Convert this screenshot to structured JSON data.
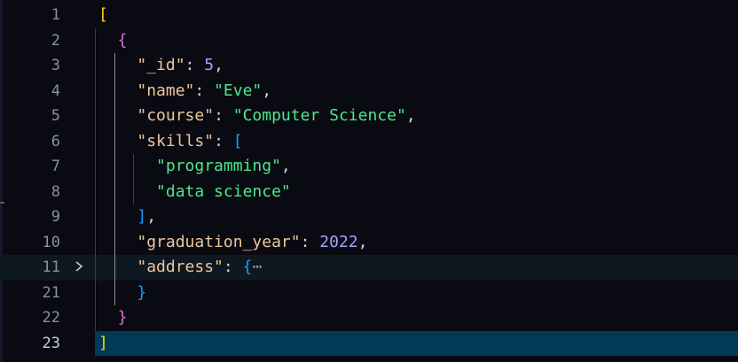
{
  "editor": {
    "lines": [
      {
        "num": "1",
        "tokens": [
          {
            "t": "[",
            "c": "t-bracket1"
          }
        ],
        "indent": 0
      },
      {
        "num": "2",
        "tokens": [
          {
            "t": "{",
            "c": "t-bracket2"
          }
        ],
        "indent": 1
      },
      {
        "num": "3",
        "tokens": [
          {
            "t": "\"_id\"",
            "c": "t-key"
          },
          {
            "t": ": ",
            "c": "t-punc"
          },
          {
            "t": "5",
            "c": "t-num"
          },
          {
            "t": ",",
            "c": "t-punc"
          }
        ],
        "indent": 2
      },
      {
        "num": "4",
        "tokens": [
          {
            "t": "\"name\"",
            "c": "t-key"
          },
          {
            "t": ": ",
            "c": "t-punc"
          },
          {
            "t": "\"Eve\"",
            "c": "t-str"
          },
          {
            "t": ",",
            "c": "t-punc"
          }
        ],
        "indent": 2
      },
      {
        "num": "5",
        "tokens": [
          {
            "t": "\"course\"",
            "c": "t-key"
          },
          {
            "t": ": ",
            "c": "t-punc"
          },
          {
            "t": "\"Computer Science\"",
            "c": "t-str"
          },
          {
            "t": ",",
            "c": "t-punc"
          }
        ],
        "indent": 2
      },
      {
        "num": "6",
        "tokens": [
          {
            "t": "\"skills\"",
            "c": "t-key"
          },
          {
            "t": ": ",
            "c": "t-punc"
          },
          {
            "t": "[",
            "c": "t-bracket3"
          }
        ],
        "indent": 2
      },
      {
        "num": "7",
        "tokens": [
          {
            "t": "\"programming\"",
            "c": "t-str"
          },
          {
            "t": ",",
            "c": "t-punc"
          }
        ],
        "indent": 3
      },
      {
        "num": "8",
        "tokens": [
          {
            "t": "\"data science\"",
            "c": "t-str"
          }
        ],
        "indent": 3
      },
      {
        "num": "9",
        "tokens": [
          {
            "t": "]",
            "c": "t-bracket3"
          },
          {
            "t": ",",
            "c": "t-punc"
          }
        ],
        "indent": 2
      },
      {
        "num": "10",
        "tokens": [
          {
            "t": "\"graduation_year\"",
            "c": "t-key"
          },
          {
            "t": ": ",
            "c": "t-punc"
          },
          {
            "t": "2022",
            "c": "t-num"
          },
          {
            "t": ",",
            "c": "t-punc"
          }
        ],
        "indent": 2
      },
      {
        "num": "11",
        "tokens": [
          {
            "t": "\"address\"",
            "c": "t-key"
          },
          {
            "t": ": ",
            "c": "t-punc"
          },
          {
            "t": "{",
            "c": "t-bracket3"
          },
          {
            "t": "⋯",
            "c": "t-ellipsis"
          }
        ],
        "indent": 2,
        "folded": true,
        "highlight": true
      },
      {
        "num": "21",
        "tokens": [
          {
            "t": "}",
            "c": "t-bracket3"
          }
        ],
        "indent": 2
      },
      {
        "num": "22",
        "tokens": [
          {
            "t": "}",
            "c": "t-bracket2"
          }
        ],
        "indent": 1
      },
      {
        "num": "23",
        "tokens": [
          {
            "t": "]",
            "c": "t-bracket1"
          }
        ],
        "indent": 0,
        "current": true
      }
    ],
    "fold_icon": "chevron-right-icon",
    "colors": {
      "background": "#090a12",
      "line_highlight": "#0e1821",
      "current_line": "#003a57",
      "bracket_level1": "#ffd700",
      "bracket_level2": "#da70d6",
      "bracket_level3": "#179fff",
      "key": "#f0c69a",
      "string": "#4ee78a",
      "number": "#a8a0ff"
    }
  }
}
